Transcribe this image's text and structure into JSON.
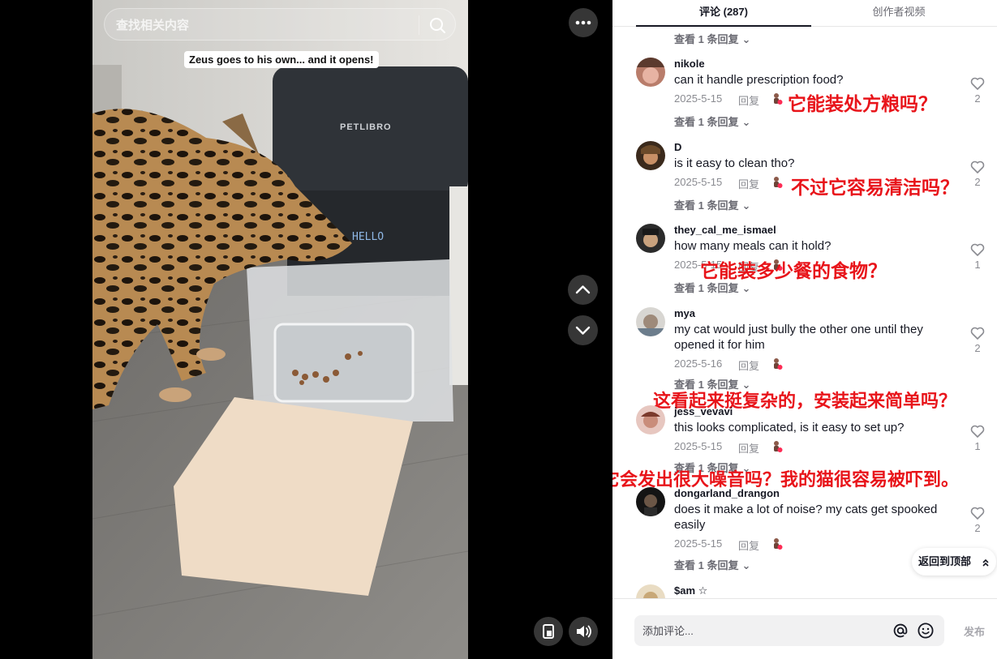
{
  "video": {
    "search_placeholder": "查找相关内容",
    "caption": "Zeus goes to his own... and it opens!",
    "feeder_brand": "PETLIBRO",
    "feeder_display": "HELLO",
    "icons": {
      "search": "search-icon",
      "more": "more-dots-icon",
      "up": "chevron-up-icon",
      "down": "chevron-down-icon",
      "mini": "mini-player-icon",
      "sound": "volume-icon"
    }
  },
  "tabs": [
    {
      "label": "评论 (287)",
      "active": true
    },
    {
      "label": "创作者视频",
      "active": false
    }
  ],
  "top_view_replies": "查看 1 条回复",
  "comments": [
    {
      "user": "nikole",
      "text": "can it handle prescription food?",
      "date": "2025-5-15",
      "reply": "回复",
      "likes": "2",
      "view_replies": "查看 1 条回复",
      "annotation": "它能装处方粮吗？"
    },
    {
      "user": "D",
      "text": "is it easy to clean tho?",
      "date": "2025-5-15",
      "reply": "回复",
      "likes": "2",
      "view_replies": "查看 1 条回复",
      "annotation": "不过它容易清洁吗？"
    },
    {
      "user": "they_cal_me_ismael",
      "text": "how many meals can it hold?",
      "date": "2025-5-15",
      "reply": "回复",
      "likes": "1",
      "view_replies": "查看 1 条回复",
      "annotation": "它能装多少餐的食物？"
    },
    {
      "user": "mya",
      "text": "my cat would just bully the other one until they opened it for him",
      "date": "2025-5-16",
      "reply": "回复",
      "likes": "2",
      "view_replies": "查看 1 条回复",
      "annotation": "这看起来挺复杂的，安装起来简单吗？"
    },
    {
      "user": "jess_vevavi",
      "text": "this looks complicated, is it easy to set up?",
      "date": "2025-5-15",
      "reply": "回复",
      "likes": "1",
      "view_replies": "查看 1 条回复",
      "annotation": "它会发出很大噪音吗？我的猫很容易被吓到。"
    },
    {
      "user": "dongarland_drangon",
      "text": "does it make a lot of noise? my cats get spooked easily",
      "date": "2025-5-15",
      "reply": "回复",
      "likes": "2",
      "view_replies": "查看 1 条回复",
      "annotation": ""
    },
    {
      "user": "$am ☆",
      "text": "",
      "date": "",
      "reply": "",
      "likes": "",
      "view_replies": "",
      "annotation": ""
    }
  ],
  "back_to_top": "返回到顶部",
  "footer": {
    "input_placeholder": "添加评论...",
    "post_label": "发布"
  },
  "colors": {
    "annotation": "#e8141a",
    "text": "#161823",
    "muted": "#8a8b91"
  }
}
